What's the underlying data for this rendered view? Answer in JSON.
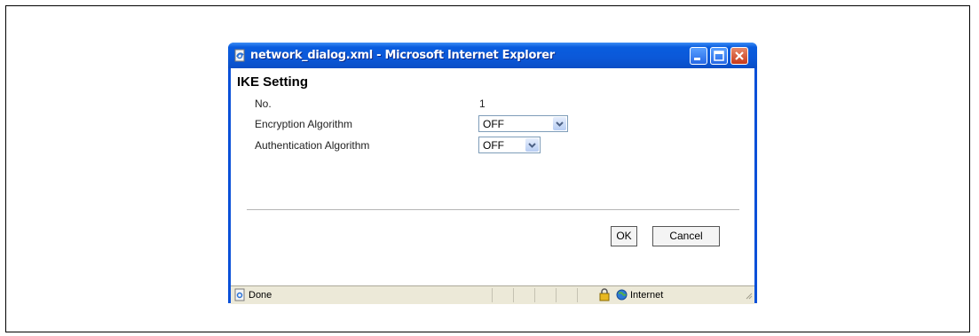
{
  "window": {
    "title": "network_dialog.xml - Microsoft Internet Explorer"
  },
  "dialog": {
    "heading": "IKE Setting",
    "no_label": "No.",
    "no_value": "1",
    "encryption_label": "Encryption Algorithm",
    "encryption_value": "OFF",
    "authentication_label": "Authentication Algorithm",
    "authentication_value": "OFF",
    "ok_label": "OK",
    "cancel_label": "Cancel"
  },
  "statusbar": {
    "status_text": "Done",
    "zone_text": "Internet"
  },
  "icons": {
    "title": "ie-document-icon",
    "minimize": "minimize-icon",
    "maximize": "maximize-icon",
    "close": "close-icon",
    "dropdown": "chevron-down-icon",
    "status": "ie-page-icon",
    "lock": "lock-icon",
    "zone": "globe-icon"
  },
  "colors": {
    "titlebar": "#0a5ddf",
    "close_button": "#c8391a",
    "statusbar": "#ece9d8"
  }
}
